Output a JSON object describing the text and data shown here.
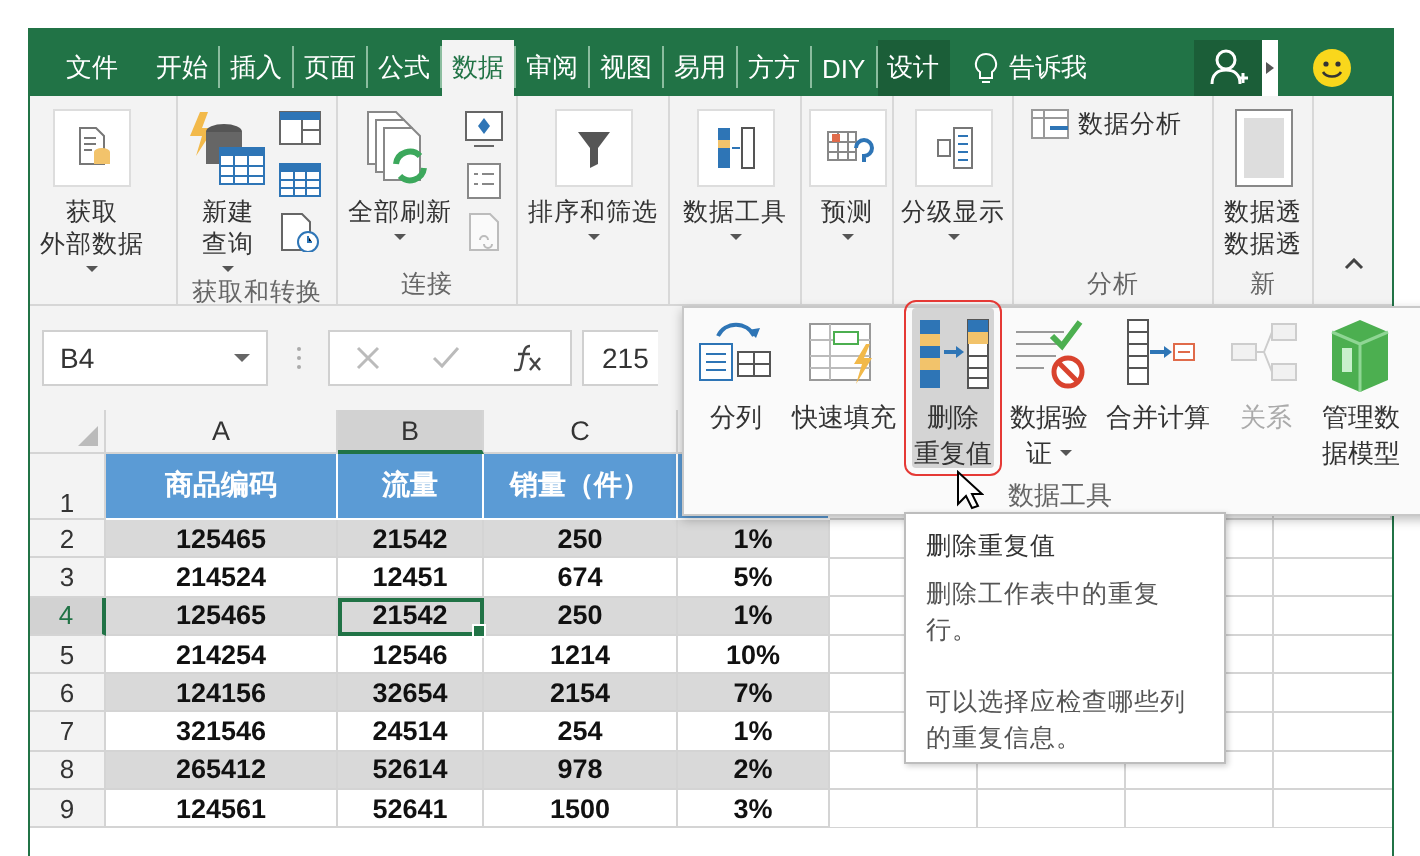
{
  "tabs": [
    {
      "label": "文件",
      "selected": false,
      "contextual": false
    },
    {
      "label": "开始",
      "selected": false,
      "contextual": false
    },
    {
      "label": "插入",
      "selected": false,
      "contextual": false
    },
    {
      "label": "页面",
      "selected": false,
      "contextual": false
    },
    {
      "label": "公式",
      "selected": false,
      "contextual": false
    },
    {
      "label": "数据",
      "selected": true,
      "contextual": false
    },
    {
      "label": "审阅",
      "selected": false,
      "contextual": false
    },
    {
      "label": "视图",
      "selected": false,
      "contextual": false
    },
    {
      "label": "易用",
      "selected": false,
      "contextual": false
    },
    {
      "label": "方方",
      "selected": false,
      "contextual": false
    },
    {
      "label": "DIY",
      "selected": false,
      "contextual": false
    },
    {
      "label": "设计",
      "selected": false,
      "contextual": true
    }
  ],
  "tell_me": "告诉我",
  "ribbon_groups": [
    {
      "items": [
        {
          "kind": "large",
          "lines": [
            "获取",
            "外部数据"
          ],
          "dropdown": true
        }
      ]
    },
    {
      "label": "获取和转换",
      "items": [
        {
          "kind": "large",
          "lines": [
            "新建",
            "查询"
          ],
          "dropdown": true
        },
        {
          "kind": "icon",
          "disabled": false
        },
        {
          "kind": "icon",
          "disabled": false
        },
        {
          "kind": "icon",
          "disabled": false
        }
      ]
    },
    {
      "label": "连接",
      "items": [
        {
          "kind": "large",
          "lines": [
            "全部刷新"
          ],
          "dropdown": true
        },
        {
          "kind": "icon",
          "disabled": false
        },
        {
          "kind": "icon",
          "disabled": false
        },
        {
          "kind": "icon",
          "disabled": true
        }
      ]
    },
    {
      "items": [
        {
          "kind": "large",
          "lines": [
            "排序和筛选"
          ],
          "dropdown": true
        }
      ]
    },
    {
      "items": [
        {
          "kind": "large",
          "lines": [
            "数据工具"
          ],
          "dropdown": true
        }
      ]
    },
    {
      "items": [
        {
          "kind": "large",
          "lines": [
            "预测"
          ],
          "dropdown": true
        }
      ]
    },
    {
      "items": [
        {
          "kind": "large",
          "lines": [
            "分级显示"
          ],
          "dropdown": true
        }
      ]
    },
    {
      "label": "分析",
      "items": [
        {
          "kind": "small",
          "lines": [
            "数据分析"
          ]
        }
      ]
    },
    {
      "label": "新",
      "items": [
        {
          "kind": "large",
          "lines": [
            "数据透",
            "数据透"
          ],
          "dropdown": false
        }
      ]
    }
  ],
  "formula_bar": {
    "name_box": "B4",
    "value": "215"
  },
  "sheet": {
    "columns": [
      {
        "label": "A",
        "selected": false
      },
      {
        "label": "B",
        "selected": true
      },
      {
        "label": "C",
        "selected": false
      }
    ],
    "header_row": {
      "number": "1",
      "cells": [
        "商品编码",
        "流量",
        "销量（件）"
      ]
    },
    "rows": [
      {
        "number": "2",
        "shaded": true,
        "selected": false,
        "cells": [
          "125465",
          "21542",
          "250",
          "1%"
        ]
      },
      {
        "number": "3",
        "shaded": false,
        "selected": false,
        "cells": [
          "214524",
          "12451",
          "674",
          "5%"
        ]
      },
      {
        "number": "4",
        "shaded": true,
        "selected": true,
        "cells": [
          "125465",
          "21542",
          "250",
          "1%"
        ]
      },
      {
        "number": "5",
        "shaded": false,
        "selected": false,
        "cells": [
          "214254",
          "12546",
          "1214",
          "10%"
        ]
      },
      {
        "number": "6",
        "shaded": true,
        "selected": false,
        "cells": [
          "124156",
          "32654",
          "2154",
          "7%"
        ]
      },
      {
        "number": "7",
        "shaded": false,
        "selected": false,
        "cells": [
          "321546",
          "24514",
          "254",
          "1%"
        ]
      },
      {
        "number": "8",
        "shaded": true,
        "selected": false,
        "cells": [
          "265412",
          "52614",
          "978",
          "2%"
        ]
      },
      {
        "number": "9",
        "shaded": false,
        "selected": false,
        "cells": [
          "124561",
          "52641",
          "1500",
          "3%"
        ]
      }
    ]
  },
  "data_tools_menu": {
    "label": "数据工具",
    "items": [
      {
        "lines": [
          "分列"
        ],
        "selected": false,
        "disabled": false,
        "dropdown": false
      },
      {
        "lines": [
          "快速填充"
        ],
        "selected": false,
        "disabled": false,
        "dropdown": false
      },
      {
        "lines": [
          "删除",
          "重复值"
        ],
        "selected": true,
        "disabled": false,
        "dropdown": false
      },
      {
        "lines": [
          "数据验",
          "证"
        ],
        "selected": false,
        "disabled": false,
        "dropdown": true
      },
      {
        "lines": [
          "合并计算"
        ],
        "selected": false,
        "disabled": false,
        "dropdown": false
      },
      {
        "lines": [
          "关系"
        ],
        "selected": false,
        "disabled": true,
        "dropdown": false
      },
      {
        "lines": [
          "管理数",
          "据模型"
        ],
        "selected": false,
        "disabled": false,
        "dropdown": false
      }
    ]
  },
  "tooltip": {
    "title": "删除重复值",
    "paragraphs": [
      "删除工作表中的重复行。",
      "可以选择应检查哪些列的重复信息。"
    ]
  }
}
